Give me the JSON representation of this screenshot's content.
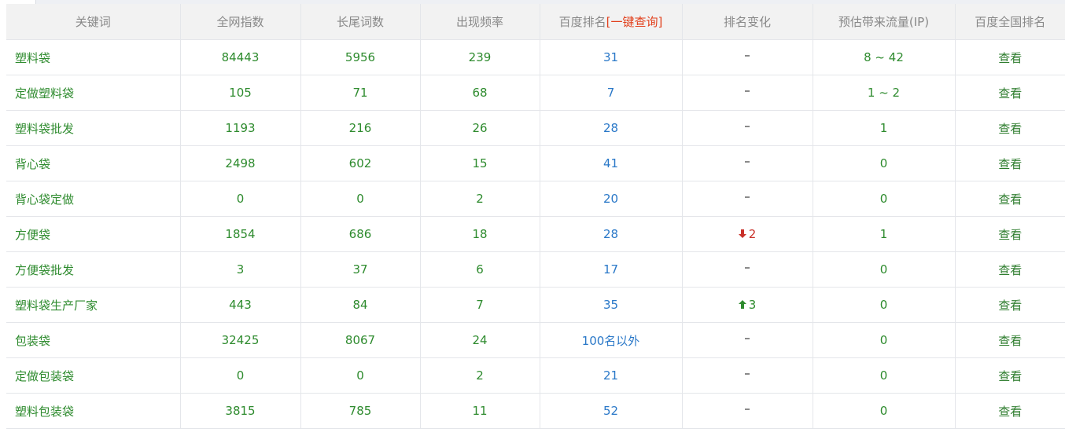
{
  "columns": {
    "keyword": "关键词",
    "index": "全网指数",
    "longtail": "长尾词数",
    "frequency": "出现频率",
    "rank_prefix": "百度排名",
    "rank_query": "[一键查询]",
    "rank_change": "排名变化",
    "traffic": "预估带来流量(IP)",
    "national_rank": "百度全国排名"
  },
  "view_label": "查看",
  "rows": [
    {
      "keyword": "塑料袋",
      "index": "84443",
      "longtail": "5956",
      "frequency": "239",
      "rank": "31",
      "change": {
        "dir": "none"
      },
      "traffic": "8 ~ 42"
    },
    {
      "keyword": "定做塑料袋",
      "index": "105",
      "longtail": "71",
      "frequency": "68",
      "rank": "7",
      "change": {
        "dir": "none"
      },
      "traffic": "1 ~ 2"
    },
    {
      "keyword": "塑料袋批发",
      "index": "1193",
      "longtail": "216",
      "frequency": "26",
      "rank": "28",
      "change": {
        "dir": "none"
      },
      "traffic": "1"
    },
    {
      "keyword": "背心袋",
      "index": "2498",
      "longtail": "602",
      "frequency": "15",
      "rank": "41",
      "change": {
        "dir": "none"
      },
      "traffic": "0"
    },
    {
      "keyword": "背心袋定做",
      "index": "0",
      "longtail": "0",
      "frequency": "2",
      "rank": "20",
      "change": {
        "dir": "none"
      },
      "traffic": "0"
    },
    {
      "keyword": "方便袋",
      "index": "1854",
      "longtail": "686",
      "frequency": "18",
      "rank": "28",
      "change": {
        "dir": "down",
        "value": "2"
      },
      "traffic": "1"
    },
    {
      "keyword": "方便袋批发",
      "index": "3",
      "longtail": "37",
      "frequency": "6",
      "rank": "17",
      "change": {
        "dir": "none"
      },
      "traffic": "0"
    },
    {
      "keyword": "塑料袋生产厂家",
      "index": "443",
      "longtail": "84",
      "frequency": "7",
      "rank": "35",
      "change": {
        "dir": "up",
        "value": "3"
      },
      "traffic": "0"
    },
    {
      "keyword": "包装袋",
      "index": "32425",
      "longtail": "8067",
      "frequency": "24",
      "rank": "100名以外",
      "change": {
        "dir": "none"
      },
      "traffic": "0"
    },
    {
      "keyword": "定做包装袋",
      "index": "0",
      "longtail": "0",
      "frequency": "2",
      "rank": "21",
      "change": {
        "dir": "none"
      },
      "traffic": "0"
    },
    {
      "keyword": "塑料包装袋",
      "index": "3815",
      "longtail": "785",
      "frequency": "11",
      "rank": "52",
      "change": {
        "dir": "none"
      },
      "traffic": "0"
    }
  ],
  "colors": {
    "keyword_text": "#2e8b2e",
    "rank_text": "#2a78c8",
    "query_link": "#e2401c",
    "rank_down": "#c9312a",
    "rank_up": "#2e8b2e",
    "header_bg": "#f2f2f2",
    "header_text": "#888888"
  }
}
